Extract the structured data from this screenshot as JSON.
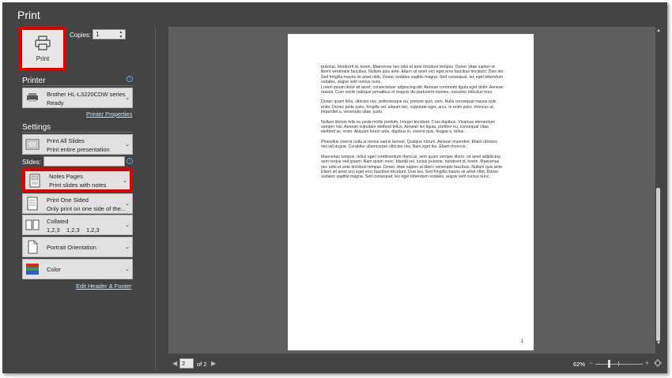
{
  "title": "Print",
  "print_button": {
    "label": "Print"
  },
  "copies": {
    "label": "Copies:",
    "value": "1"
  },
  "printer": {
    "heading": "Printer",
    "name": "Brother HL-L3220CDW series...",
    "status": "Ready",
    "properties_link": "Printer Properties"
  },
  "settings": {
    "heading": "Settings",
    "slides_range": {
      "title": "Print All Slides",
      "subtitle": "Print entire presentation"
    },
    "slides_label": "Slides:",
    "layout": {
      "title": "Notes Pages",
      "subtitle": "Print slides with notes"
    },
    "sides": {
      "title": "Print One Sided",
      "subtitle": "Only print on one side of the..."
    },
    "collation": {
      "title": "Collated",
      "subtitle": "1,2,3    1,2,3    1,2,3"
    },
    "orientation": {
      "title": "Portrait Orientation"
    },
    "color": {
      "title": "Color"
    },
    "header_footer_link": "Edit Header & Footer"
  },
  "preview": {
    "paragraphs": [
      "pulvinar, hendrerit id, lorem. Maecenas nec odio et ante tincidunt tempus. Donec vitae sapien ut libero venenatis faucibus. Nullam quis ante. Etiam sit amet orci eget eros faucibus tincidunt. Duis leo. Sed fringilla mauris sit amet nibh. Donec sodales sagittis magna. Sed consequat, leo eget bibendum sodales, augue velit cursus nunc,\nLorem ipsum dolor sit amet, consectetuer adipiscing elit. Aenean commodo ligula eget dolor. Aenean massa. Cum sociis natoque penatibus et magnis dis parturient montes, nascetur ridiculus mus.",
      "Donec quam felis, ultricies nec, pellentesque eu, pretium quis, sem. Nulla consequat massa quis enim. Donec pede justo, fringilla vel, aliquet nec, vulputate eget, arcu. In enim justo, rhoncus ut, imperdiet a, venenatis vitae, justo.",
      "Nullam dictum felis eu pede mollis pretium. Integer tincidunt. Cras dapibus. Vivamus elementum semper nisi. Aenean vulputate eleifend tellus. Aenean leo ligula, porttitor eu, consequat vitae, eleifend ac, enim. Aliquam lorem ante, dapibus in, viverra quis, feugiat a, tellus.",
      "Phasellus viverra nulla ut metus varius laoreet. Quisque rutrum. Aenean imperdiet. Etiam ultricies nisi vel augue. Curabitur ullamcorper ultricies nisi. Nam eget dui. Etiam rhoncus.",
      "Maecenas tempus, tellus eget condimentum rhoncus, sem quam semper libero, sit amet adipiscing sem neque sed ipsum. Nam quam nunc, blandit vel, luctus pulvinar, hendrerit id, lorem. Maecenas nec odio et ante tincidunt tempus. Donec vitae sapien ut libero venenatis faucibus. Nullam quis ante. Etiam sit amet orci eget eros faucibus tincidunt. Duis leo. Sed fringilla mauris sit amet nibh. Donec sodales sagittis magna. Sed consequat, leo eget bibendum sodales, augue velit cursus nunc,"
    ],
    "page_number": "1"
  },
  "navigation": {
    "current_page": "2",
    "of_label": "of 2"
  },
  "zoom": {
    "label": "62%",
    "level_percent": 62
  },
  "icons": [
    "printer-icon",
    "info-icon",
    "chevron-down-icon",
    "chevron-left-icon",
    "chevron-right-icon",
    "fit-to-window-icon"
  ]
}
